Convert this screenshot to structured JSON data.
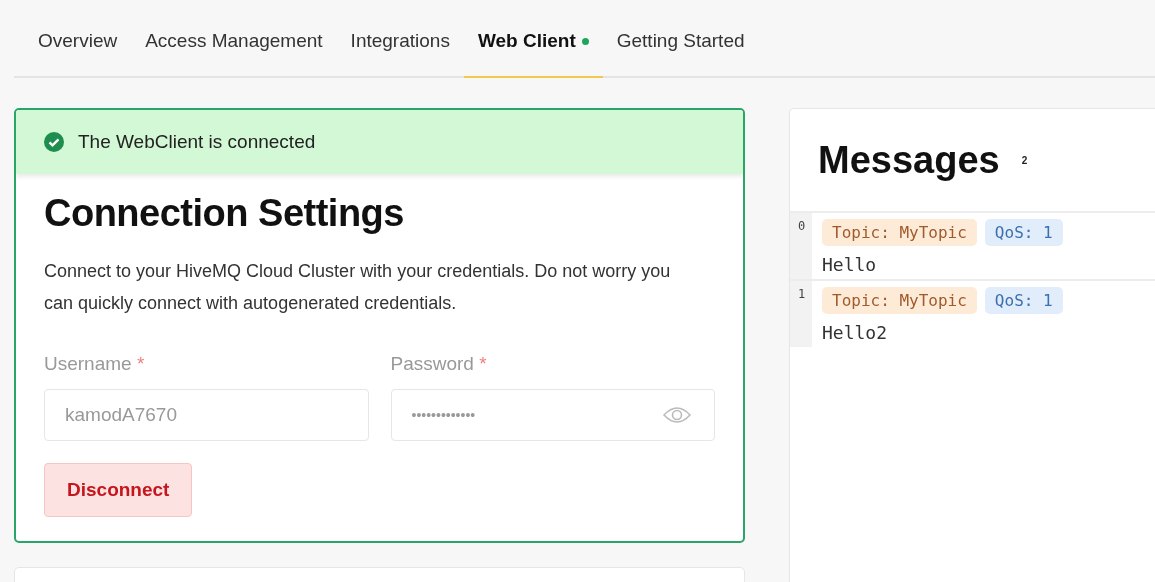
{
  "tabs": [
    {
      "label": "Overview",
      "selected": false,
      "status_dot": false
    },
    {
      "label": "Access Management",
      "selected": false,
      "status_dot": false
    },
    {
      "label": "Integrations",
      "selected": false,
      "status_dot": false
    },
    {
      "label": "Web Client",
      "selected": true,
      "status_dot": true
    },
    {
      "label": "Getting Started",
      "selected": false,
      "status_dot": false
    }
  ],
  "connection": {
    "status": "The WebClient is connected",
    "connected": true,
    "title": "Connection Settings",
    "description": "Connect to your HiveMQ Cloud Cluster with your credentials. Do not worry you can quickly connect with autogenerated credentials.",
    "fields": [
      {
        "label": "Username",
        "required_mark": "*",
        "value": "kamodA7670",
        "kind": "text"
      },
      {
        "label": "Password",
        "required_mark": "*",
        "value": "•••••••••••••",
        "kind": "password"
      }
    ],
    "button": "Disconnect"
  },
  "messages": {
    "title": "Messages",
    "count": "2",
    "items": [
      {
        "index": "0",
        "topic": "Topic: MyTopic",
        "qos": "QoS: 1",
        "payload": "Hello"
      },
      {
        "index": "1",
        "topic": "Topic: MyTopic",
        "qos": "QoS: 1",
        "payload": "Hello2"
      }
    ]
  }
}
